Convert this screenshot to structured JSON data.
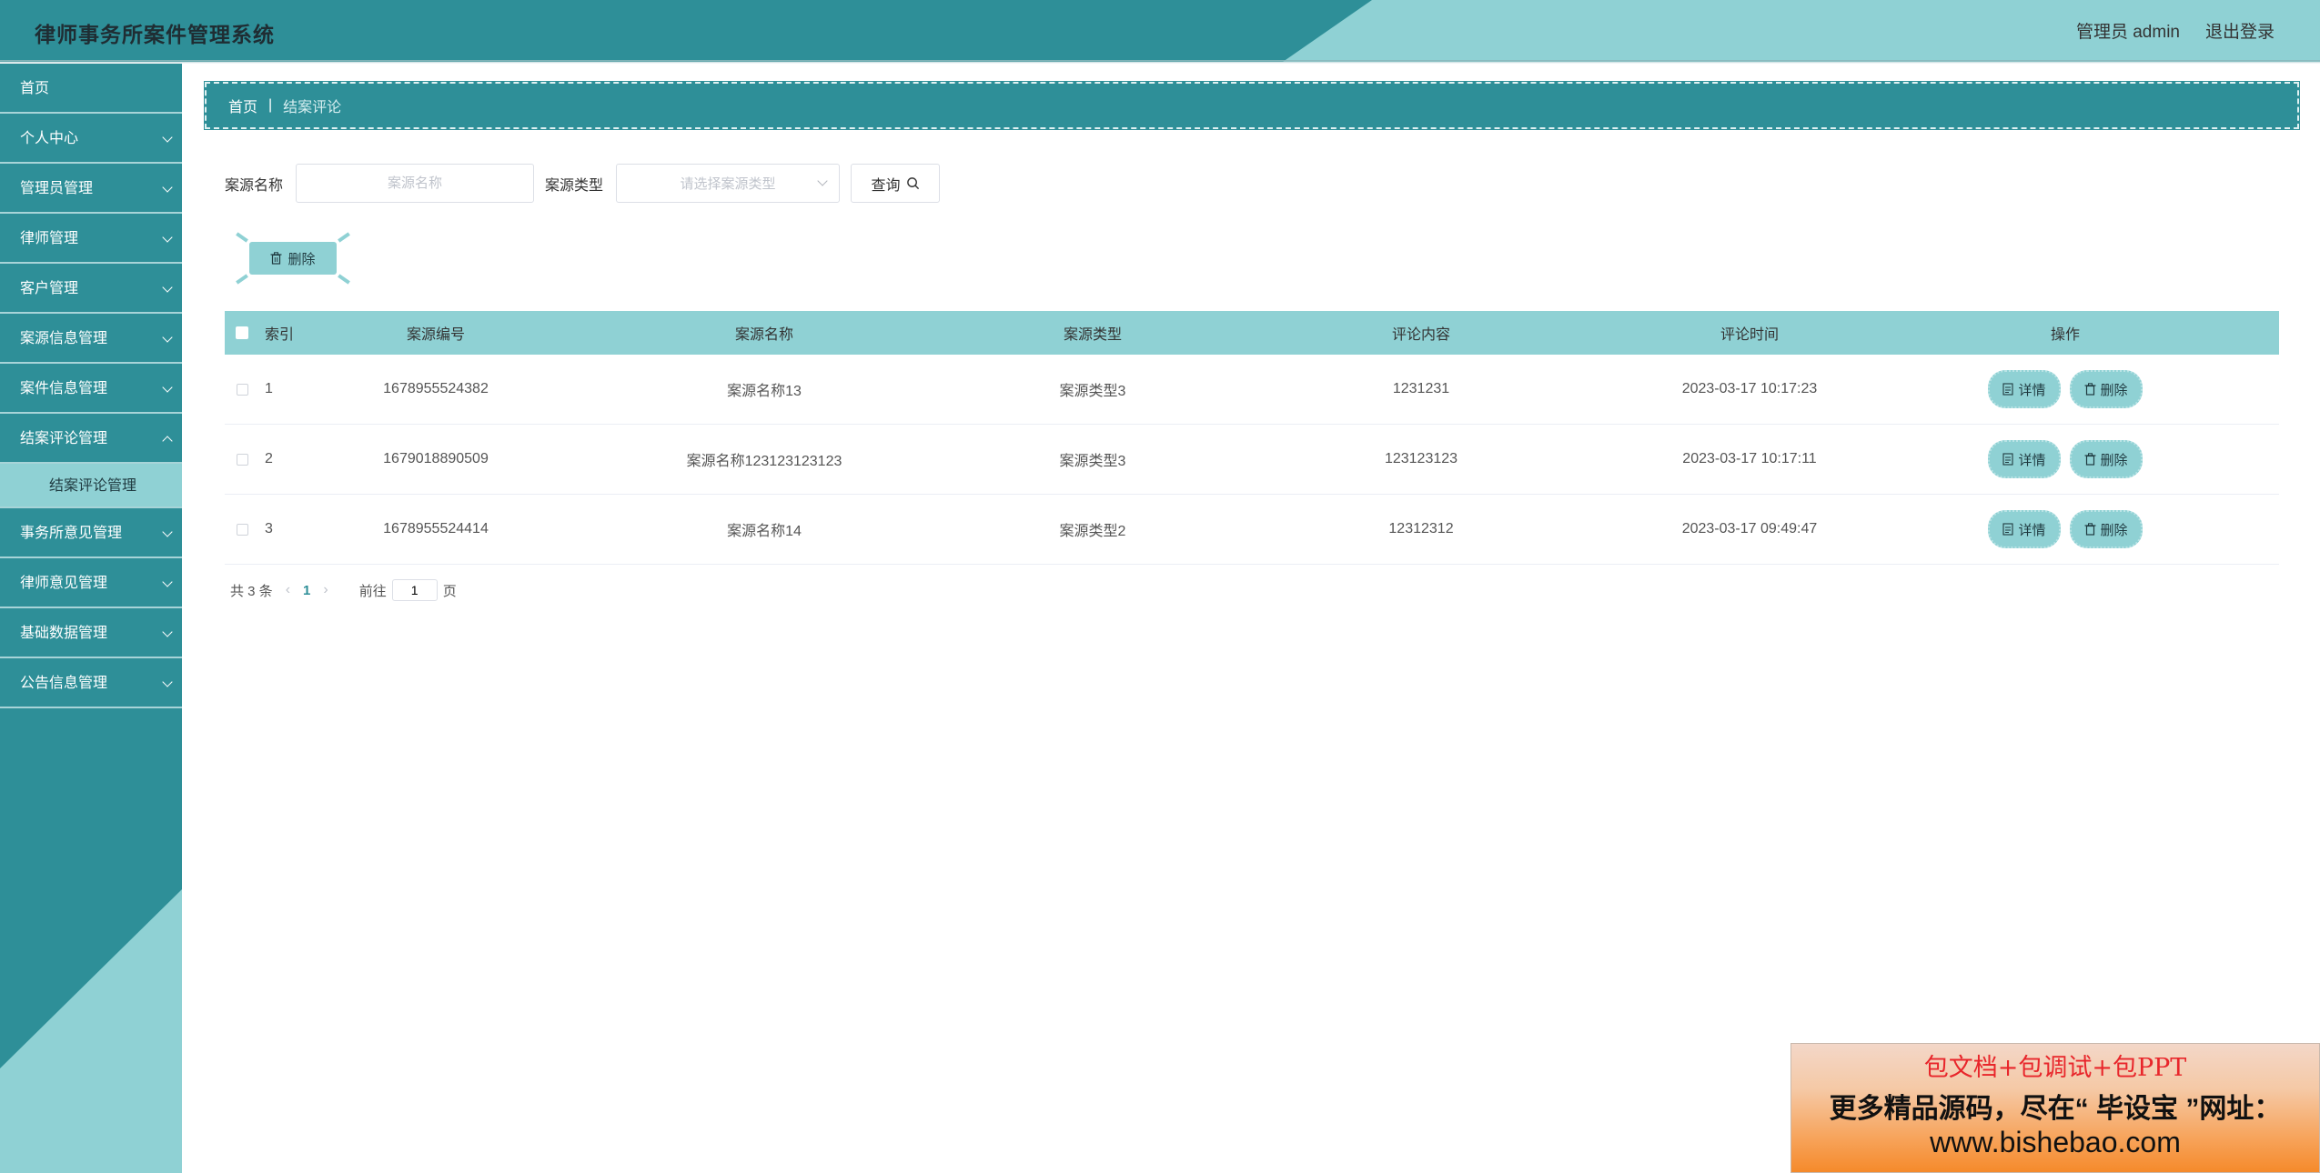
{
  "header": {
    "title": "律师事务所案件管理系统",
    "user_label": "管理员 admin",
    "logout_label": "退出登录"
  },
  "sidebar": {
    "items": [
      {
        "label": "首页",
        "has_arrow": false
      },
      {
        "label": "个人中心",
        "has_arrow": true
      },
      {
        "label": "管理员管理",
        "has_arrow": true
      },
      {
        "label": "律师管理",
        "has_arrow": true
      },
      {
        "label": "客户管理",
        "has_arrow": true
      },
      {
        "label": "案源信息管理",
        "has_arrow": true
      },
      {
        "label": "案件信息管理",
        "has_arrow": true
      },
      {
        "label": "结案评论管理",
        "has_arrow": true,
        "open": true
      },
      {
        "label": "事务所意见管理",
        "has_arrow": true
      },
      {
        "label": "律师意见管理",
        "has_arrow": true
      },
      {
        "label": "基础数据管理",
        "has_arrow": true
      },
      {
        "label": "公告信息管理",
        "has_arrow": true
      }
    ],
    "submenu": {
      "label": "结案评论管理"
    }
  },
  "breadcrumb": {
    "home": "首页",
    "separator": "|",
    "current": "结案评论"
  },
  "search": {
    "name_label": "案源名称",
    "name_placeholder": "案源名称",
    "name_value": "",
    "type_label": "案源类型",
    "type_placeholder": "请选择案源类型",
    "query_label": "查询"
  },
  "actions": {
    "bulk_delete_label": "删除"
  },
  "table": {
    "headers": {
      "index": "索引",
      "code": "案源编号",
      "name": "案源名称",
      "type": "案源类型",
      "comment": "评论内容",
      "time": "评论时间",
      "ops": "操作"
    },
    "rows": [
      {
        "index": "1",
        "code": "1678955524382",
        "name": "案源名称13",
        "type": "案源类型3",
        "comment": "1231231",
        "time": "2023-03-17 10:17:23"
      },
      {
        "index": "2",
        "code": "1679018890509",
        "name": "案源名称123123123123",
        "type": "案源类型3",
        "comment": "123123123",
        "time": "2023-03-17 10:17:11"
      },
      {
        "index": "3",
        "code": "1678955524414",
        "name": "案源名称14",
        "type": "案源类型2",
        "comment": "12312312",
        "time": "2023-03-17 09:49:47"
      }
    ],
    "detail_label": "详情",
    "delete_label": "删除"
  },
  "pagination": {
    "total_text": "共 3 条",
    "current_page": "1",
    "goto_prefix": "前往",
    "goto_value": "1",
    "goto_suffix": "页"
  },
  "ad": {
    "line1": "包文档+包调试+包PPT",
    "line2": "更多精品源码，尽在“ 毕设宝 ”网址：",
    "line3": "www.bishebao.com"
  },
  "colors": {
    "primary": "#2e8f98",
    "accent_light": "#8fd1d4",
    "ad_red": "#e8262b",
    "ad_orange": "#f58a2b"
  },
  "icons": {
    "query": "search-icon",
    "delete": "trash-icon",
    "detail": "document-icon",
    "submenu_arrow": "chevron-down-icon"
  }
}
